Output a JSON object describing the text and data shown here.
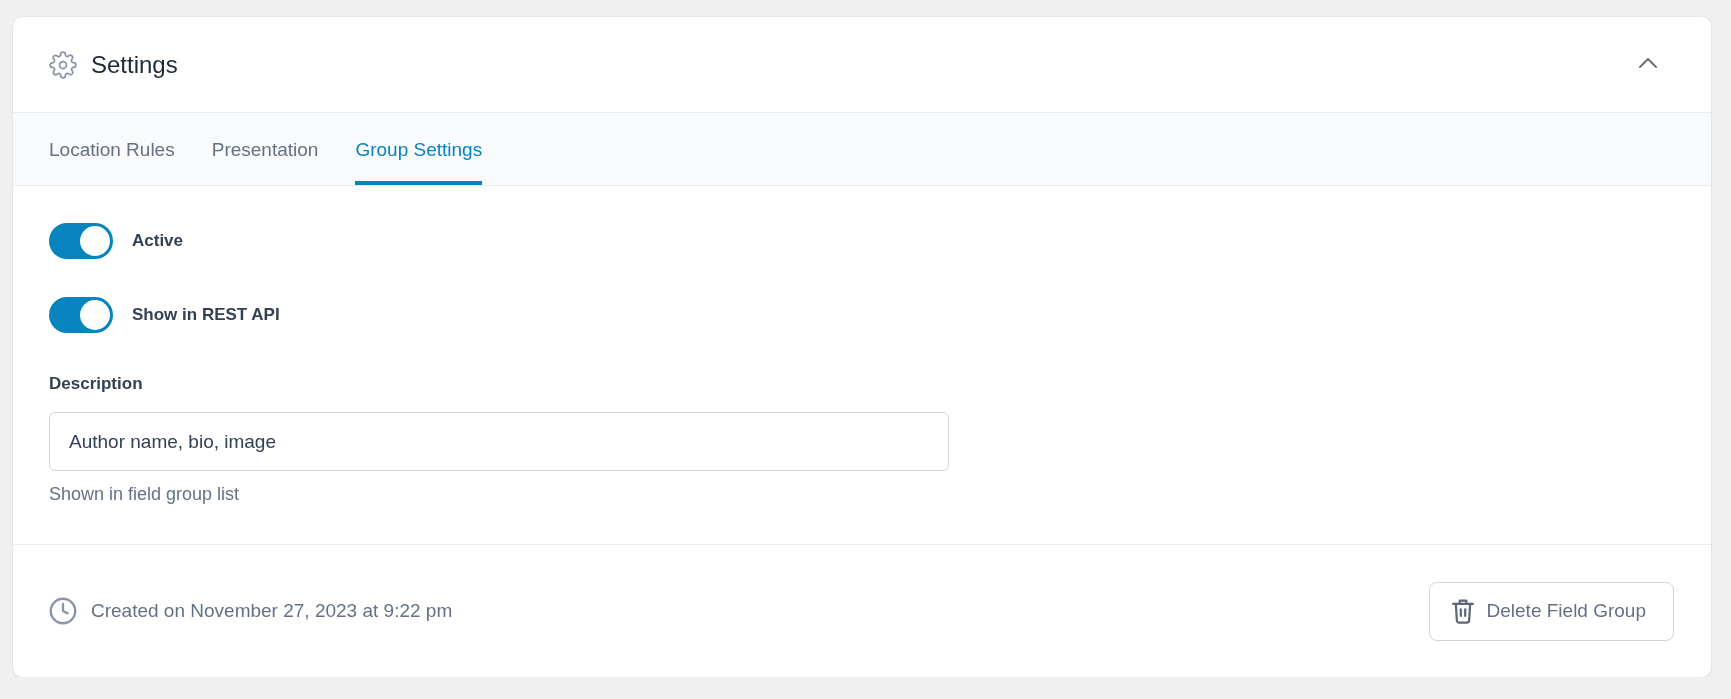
{
  "panel": {
    "title": "Settings",
    "expanded": true
  },
  "tabs": [
    {
      "label": "Location Rules",
      "selected": false
    },
    {
      "label": "Presentation",
      "selected": false
    },
    {
      "label": "Group Settings",
      "selected": true
    }
  ],
  "toggles": [
    {
      "label": "Active",
      "on": true
    },
    {
      "label": "Show in REST API",
      "on": true
    }
  ],
  "description": {
    "label": "Description",
    "value": "Author name, bio, image",
    "hint": "Shown in field group list"
  },
  "footer": {
    "created": "Created on November 27, 2023 at 9:22 pm",
    "delete_button": "Delete Field Group"
  }
}
